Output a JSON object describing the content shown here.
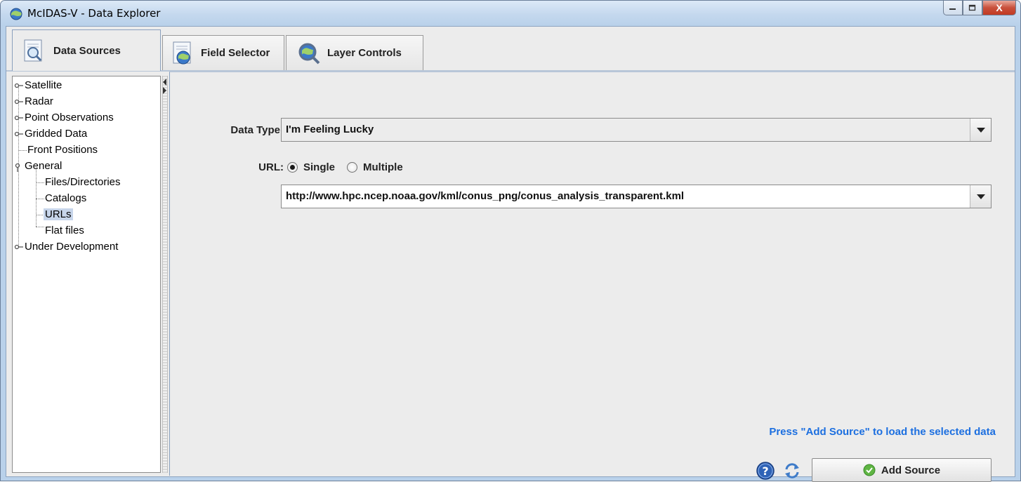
{
  "window": {
    "title": "McIDAS-V - Data Explorer",
    "controls": [
      "minimize",
      "maximize",
      "close"
    ],
    "close_label": "X"
  },
  "tabs": [
    {
      "label": "Data Sources",
      "icon": "data-sources-magnifier-icon",
      "active": true
    },
    {
      "label": "Field Selector",
      "icon": "field-selector-globe-icon",
      "active": false
    },
    {
      "label": "Layer Controls",
      "icon": "layer-controls-magnifier-icon",
      "active": false
    }
  ],
  "tree": {
    "items": [
      {
        "label": "Satellite",
        "expandable": true
      },
      {
        "label": "Radar",
        "expandable": true
      },
      {
        "label": "Point Observations",
        "expandable": true
      },
      {
        "label": "Gridded Data",
        "expandable": true
      },
      {
        "label": "Front Positions",
        "expandable": false
      },
      {
        "label": "General",
        "expandable": true,
        "expanded": true
      },
      {
        "label": "Files/Directories",
        "child": true
      },
      {
        "label": "Catalogs",
        "child": true
      },
      {
        "label": "URLs",
        "child": true,
        "selected": true
      },
      {
        "label": "Flat files",
        "child": true
      },
      {
        "label": "Under Development",
        "expandable": true
      }
    ]
  },
  "form": {
    "data_type_label": "Data Type:",
    "data_type_value": "I'm Feeling Lucky",
    "url_label": "URL:",
    "radio_single": "Single",
    "radio_multiple": "Multiple",
    "selected_radio": "Single",
    "url_value": "http://www.hpc.ncep.noaa.gov/kml/conus_png/conus_analysis_transparent.kml"
  },
  "status_text": "Press \"Add Source\" to load the selected data",
  "footer": {
    "help_icon": "help-icon",
    "refresh_icon": "refresh-icon",
    "add_source_label": "Add Source",
    "add_source_icon": "checkmark-icon"
  },
  "colors": {
    "status_blue": "#1c6fe0",
    "selection": "#c7d5ea",
    "title_bar": "#c4d8ee",
    "close_red": "#c8503b"
  }
}
